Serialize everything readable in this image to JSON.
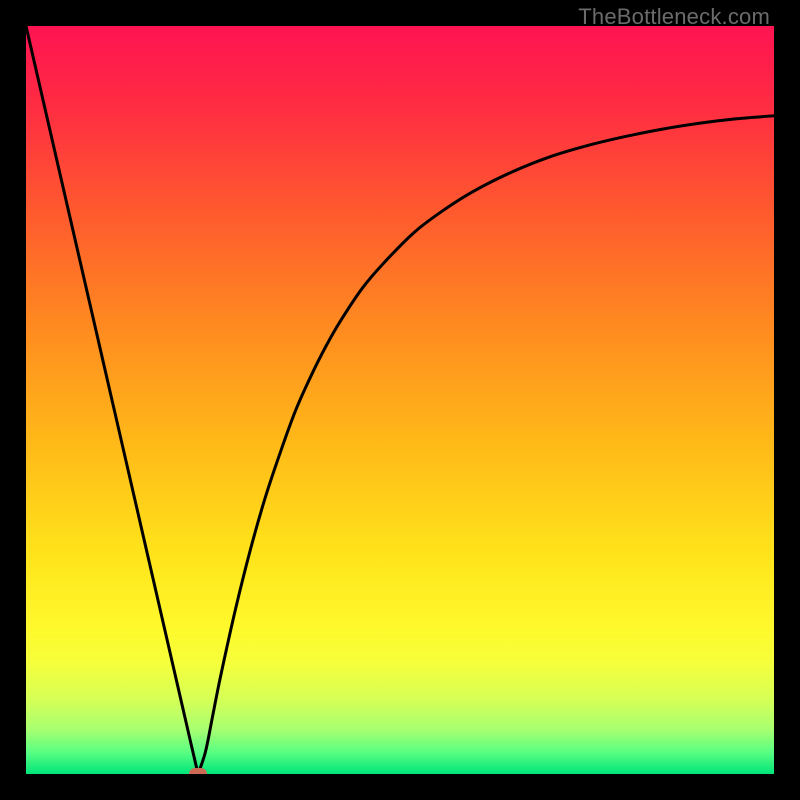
{
  "watermark": "TheBottleneck.com",
  "colors": {
    "gradient_stops": [
      {
        "offset": 0.0,
        "color": "#ff1452"
      },
      {
        "offset": 0.1,
        "color": "#ff2a43"
      },
      {
        "offset": 0.25,
        "color": "#ff5a2e"
      },
      {
        "offset": 0.4,
        "color": "#ff8a20"
      },
      {
        "offset": 0.55,
        "color": "#ffb718"
      },
      {
        "offset": 0.7,
        "color": "#ffe21a"
      },
      {
        "offset": 0.8,
        "color": "#fff82a"
      },
      {
        "offset": 0.85,
        "color": "#f6ff3a"
      },
      {
        "offset": 0.9,
        "color": "#d6ff56"
      },
      {
        "offset": 0.94,
        "color": "#a8ff70"
      },
      {
        "offset": 0.97,
        "color": "#5cff82"
      },
      {
        "offset": 1.0,
        "color": "#00e57a"
      }
    ],
    "curve": "#000000",
    "marker": "#cc6a55",
    "frame": "#000000"
  },
  "chart_data": {
    "type": "line",
    "title": "",
    "xlabel": "",
    "ylabel": "",
    "xlim": [
      0,
      100
    ],
    "ylim": [
      0,
      100
    ],
    "series": [
      {
        "name": "bottleneck-curve",
        "x": [
          0,
          2,
          4,
          6,
          8,
          10,
          12,
          14,
          16,
          18,
          20,
          22,
          23,
          24,
          25,
          26,
          28,
          30,
          32,
          34,
          36,
          38,
          40,
          42,
          45,
          48,
          52,
          56,
          60,
          65,
          70,
          75,
          80,
          85,
          90,
          95,
          100
        ],
        "y": [
          100,
          91.3,
          82.6,
          73.9,
          65.2,
          56.5,
          47.8,
          39.1,
          30.4,
          21.7,
          13.0,
          4.3,
          0.0,
          3.0,
          8.0,
          13.0,
          22.0,
          30.0,
          37.0,
          43.0,
          48.5,
          53.0,
          57.0,
          60.5,
          65.0,
          68.5,
          72.5,
          75.5,
          78.0,
          80.5,
          82.5,
          84.0,
          85.2,
          86.2,
          87.0,
          87.6,
          88.0
        ]
      }
    ],
    "marker": {
      "x": 23,
      "y": 0
    }
  }
}
